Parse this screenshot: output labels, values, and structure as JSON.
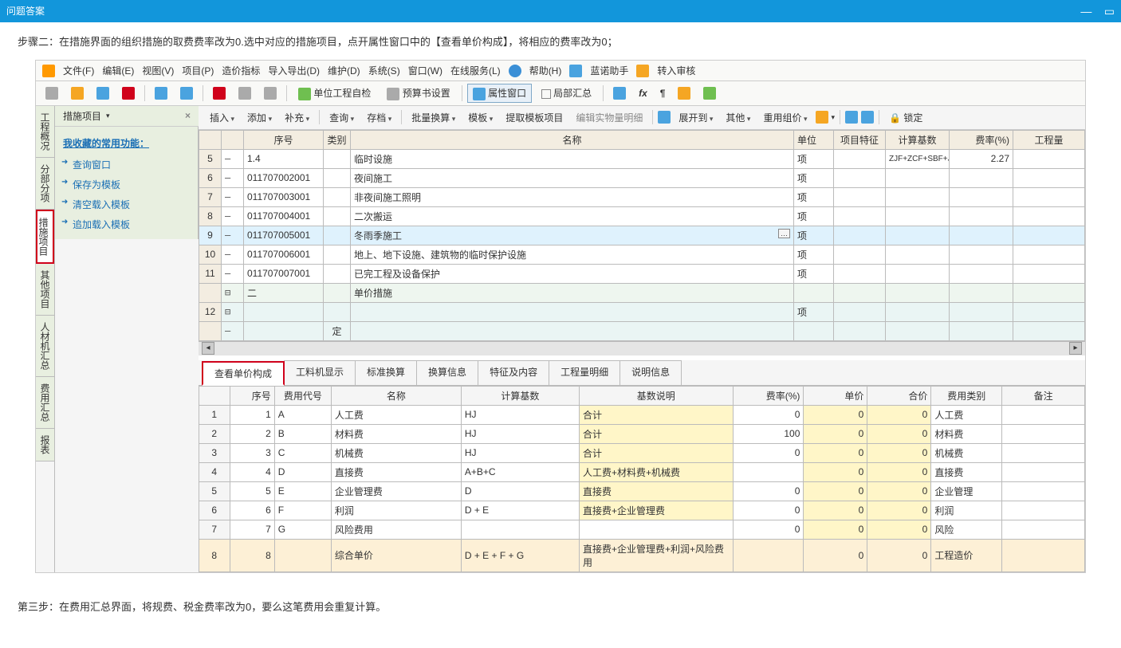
{
  "title": "问题答案",
  "step2": "步骤二：在措施界面的组织措施的取费费率改为0.选中对应的措施项目，点开属性窗口中的【查看单价构成】，将相应的费率改为0；",
  "step3": "第三步：在费用汇总界面，将规费、税金费率改为0，要么这笔费用会重复计算。",
  "menu": {
    "file": "文件(F)",
    "edit": "编辑(E)",
    "view": "视图(V)",
    "project": "项目(P)",
    "cost": "造价指标",
    "io": "导入导出(D)",
    "maint": "维护(D)",
    "sys": "系统(S)",
    "win": "窗口(W)",
    "online": "在线服务(L)",
    "help": "帮助(H)",
    "assist": "蓝诺助手",
    "audit": "转入审核"
  },
  "tb1": {
    "unit_check": "单位工程自检",
    "budget": "预算书设置",
    "prop": "属性窗口",
    "bureau": "局部汇总"
  },
  "sidehdr": "措施项目",
  "fav": {
    "title": "我收藏的常用功能：",
    "items": [
      "查询窗口",
      "保存为模板",
      "清空载入模板",
      "追加载入模板"
    ]
  },
  "vtabs": [
    "工程概况",
    "分部分项",
    "措施项目",
    "其他项目",
    "人材机汇总",
    "费用汇总",
    "报表"
  ],
  "tb2": {
    "insert": "插入",
    "add": "添加",
    "supp": "补充",
    "query": "查询",
    "save": "存档",
    "batch": "批量换算",
    "tpl": "模板",
    "extract": "提取模板项目",
    "detail": "编辑实物量明细",
    "expand": "展开到",
    "other": "其他",
    "regroup": "重用组价",
    "lock": "锁定"
  },
  "grid1": {
    "hdr": {
      "seq": "序号",
      "cat": "类别",
      "name": "名称",
      "unit": "单位",
      "feat": "项目特征",
      "base": "计算基数",
      "rate": "费率(%)",
      "amt": "工程量"
    },
    "rows": [
      {
        "n": "5",
        "seq": "1.4",
        "name": "临时设施",
        "unit": "项",
        "base": "ZJF+ZCF+SBF+JSCS_ZJF+JSCS_ZCF+JSCS_SBF",
        "rate": "2.27",
        "cls": ""
      },
      {
        "n": "6",
        "seq": "011707002001",
        "name": "夜间施工",
        "unit": "项",
        "cls": ""
      },
      {
        "n": "7",
        "seq": "011707003001",
        "name": "非夜间施工照明",
        "unit": "项",
        "cls": ""
      },
      {
        "n": "8",
        "seq": "011707004001",
        "name": "二次搬运",
        "unit": "项",
        "cls": ""
      },
      {
        "n": "9",
        "seq": "011707005001",
        "name": "冬雨季施工",
        "unit": "项",
        "cls": "sel",
        "more": true
      },
      {
        "n": "10",
        "seq": "011707006001",
        "name": "地上、地下设施、建筑物的临时保护设施",
        "unit": "项",
        "cls": ""
      },
      {
        "n": "11",
        "seq": "011707007001",
        "name": "已完工程及设备保护",
        "unit": "项",
        "cls": ""
      },
      {
        "n": "",
        "seq": "二",
        "name": "单价措施",
        "cls": "sec",
        "tree": "⊟"
      },
      {
        "n": "12",
        "seq": "",
        "name": "",
        "unit": "项",
        "cls": "blank",
        "tree": "⊟"
      },
      {
        "n": "",
        "seq": "",
        "cat": "定",
        "name": "",
        "cls": "blank"
      }
    ]
  },
  "tabs2": [
    "查看单价构成",
    "工料机显示",
    "标准换算",
    "换算信息",
    "特征及内容",
    "工程量明细",
    "说明信息"
  ],
  "grid2": {
    "hdr": {
      "sn": "序号",
      "cd": "费用代号",
      "nm": "名称",
      "bs": "计算基数",
      "ds": "基数说明",
      "rt": "费率(%)",
      "up": "单价",
      "tt": "合价",
      "tp": "费用类别",
      "rm": "备注"
    },
    "rows": [
      {
        "n": "1",
        "sn": "1",
        "cd": "A",
        "nm": "人工费",
        "bs": "HJ",
        "ds": "合计",
        "rt": "0",
        "up": "0",
        "tt": "0",
        "tp": "人工费",
        "dsy": true
      },
      {
        "n": "2",
        "sn": "2",
        "cd": "B",
        "nm": "材料费",
        "bs": "HJ",
        "ds": "合计",
        "rt": "100",
        "up": "0",
        "tt": "0",
        "tp": "材料费",
        "dsy": true
      },
      {
        "n": "3",
        "sn": "3",
        "cd": "C",
        "nm": "机械费",
        "bs": "HJ",
        "ds": "合计",
        "rt": "0",
        "up": "0",
        "tt": "0",
        "tp": "机械费",
        "dsy": true
      },
      {
        "n": "4",
        "sn": "4",
        "cd": "D",
        "nm": "直接费",
        "bs": "A+B+C",
        "ds": "人工费+材料费+机械费",
        "rt": "",
        "up": "0",
        "tt": "0",
        "tp": "直接费",
        "dsy": true
      },
      {
        "n": "5",
        "sn": "5",
        "cd": "E",
        "nm": "企业管理费",
        "bs": "D",
        "ds": "直接费",
        "rt": "0",
        "up": "0",
        "tt": "0",
        "tp": "企业管理",
        "hl": true,
        "dsy": true
      },
      {
        "n": "6",
        "sn": "6",
        "cd": "F",
        "nm": "利润",
        "bs": "D + E",
        "ds": "直接费+企业管理费",
        "rt": "0",
        "up": "0",
        "tt": "0",
        "tp": "利润",
        "hl": true,
        "dsy": true
      },
      {
        "n": "7",
        "sn": "7",
        "cd": "G",
        "nm": "风险费用",
        "bs": "",
        "ds": "",
        "rt": "0",
        "up": "0",
        "tt": "0",
        "tp": "风险",
        "hl": true
      },
      {
        "n": "8",
        "sn": "8",
        "cd": "",
        "nm": "综合单价",
        "bs": "D + E + F + G",
        "ds": "直接费+企业管理费+利润+风险费用",
        "rt": "",
        "up": "0",
        "tt": "0",
        "tp": "工程造价",
        "last": true,
        "dsy": true
      }
    ]
  }
}
